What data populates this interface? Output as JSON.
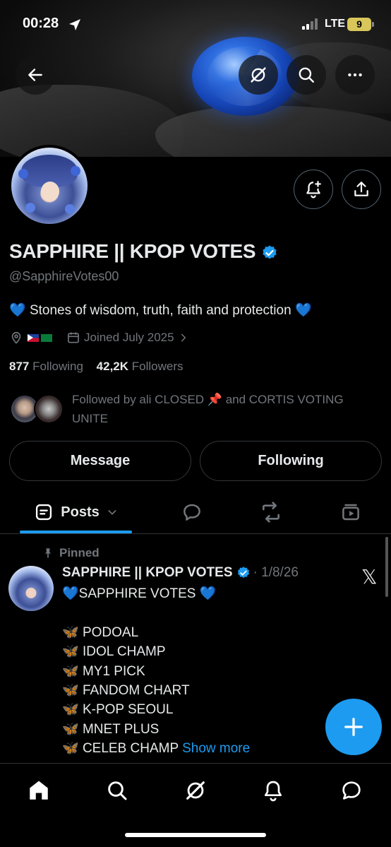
{
  "status_bar": {
    "time": "00:28",
    "network": "LTE",
    "battery": "9"
  },
  "profile": {
    "name": "SAPPHIRE || KPOP VOTES",
    "handle": "@SapphireVotes00",
    "bio": "Stones of wisdom, truth, faith and protection",
    "joined": "Joined July 2025",
    "following_count": "877",
    "following_label": "Following",
    "followers_count": "42,2K",
    "followers_label": "Followers",
    "followed_by": "Followed by ali CLOSED 📌 and CORTIS VOTING UNITE"
  },
  "buttons": {
    "message": "Message",
    "following": "Following"
  },
  "tabs": {
    "posts": "Posts"
  },
  "post": {
    "pinned_label": "Pinned",
    "author": "SAPPHIRE || KPOP VOTES",
    "date": "· 1/8/26",
    "heading": "SAPPHIRE VOTES",
    "items": [
      "PODOAL",
      "IDOL CHAMP",
      "MY1 PICK",
      "FANDOM CHART",
      "K-POP SEOUL",
      "MNET PLUS",
      "CELEB CHAMP"
    ],
    "show_more": "Show more"
  },
  "colors": {
    "accent": "#1d9bf0",
    "background": "#000000",
    "muted_text": "#71767b",
    "text": "#e7e9ea"
  },
  "icons": [
    "back-arrow-icon",
    "grok-icon",
    "search-icon",
    "more-icon",
    "notification-add-icon",
    "share-icon",
    "location-icon",
    "calendar-icon",
    "chevron-right-icon",
    "posts-icon",
    "chevron-down-icon",
    "replies-icon",
    "repost-icon",
    "media-icon",
    "pin-icon",
    "verified-icon",
    "x-logo-icon",
    "compose-plus-icon",
    "home-icon",
    "grok-nav-icon",
    "bell-icon",
    "messages-icon"
  ]
}
